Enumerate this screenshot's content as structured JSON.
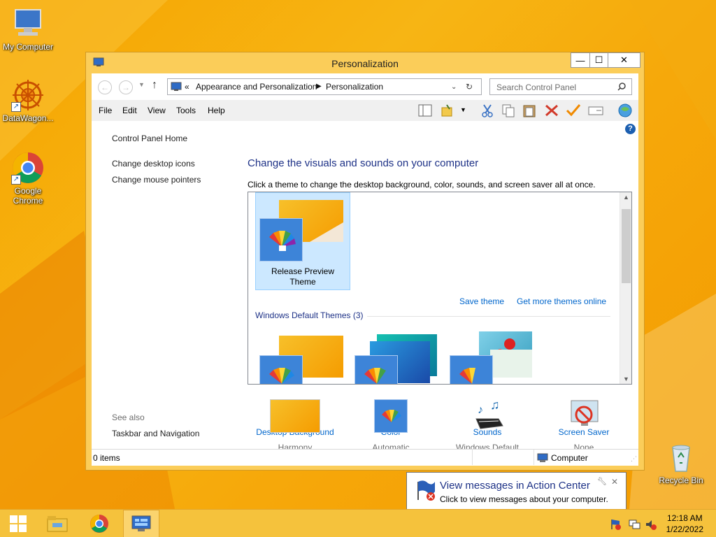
{
  "desktop": {
    "icons": [
      {
        "label": "My Computer"
      },
      {
        "label": "DataWagon..."
      },
      {
        "label": "Google Chrome"
      },
      {
        "label": "Recycle Bin"
      }
    ]
  },
  "window": {
    "title": "Personalization",
    "controls": {
      "minimize": "—",
      "maximize": "☐",
      "close": "✕"
    },
    "address": {
      "prefix": "«",
      "crumbs": [
        "Appearance and Personalization",
        "Personalization"
      ]
    },
    "search_placeholder": "Search Control Panel",
    "menu": [
      "File",
      "Edit",
      "View",
      "Tools",
      "Help"
    ],
    "left_nav": {
      "home": "Control Panel Home",
      "links": [
        "Change desktop icons",
        "Change mouse pointers"
      ],
      "see_also_label": "See also",
      "see_also_links": [
        "Taskbar and Navigation"
      ]
    },
    "heading": "Change the visuals and sounds on your computer",
    "subtext": "Click a theme to change the desktop background, color, sounds, and screen saver all at once.",
    "my_theme": {
      "name_line1": "Release Preview",
      "name_line2": "Theme"
    },
    "save_theme": "Save theme",
    "get_more": "Get more themes online",
    "default_group": "Windows Default Themes (3)",
    "bottom": [
      {
        "label": "Desktop Background",
        "value": "Harmony"
      },
      {
        "label": "Color",
        "value": "Automatic"
      },
      {
        "label": "Sounds",
        "value": "Windows Default"
      },
      {
        "label": "Screen Saver",
        "value": "None"
      }
    ],
    "status": {
      "items": "0 items",
      "location": "Computer"
    }
  },
  "notification": {
    "title": "View messages in Action Center",
    "body": "Click to view messages about your computer."
  },
  "taskbar": {
    "time": "12:18 AM",
    "date": "1/22/2022"
  },
  "colors": {
    "accent": "#f6a400",
    "link": "#0066cc",
    "heading": "#1e3287"
  }
}
